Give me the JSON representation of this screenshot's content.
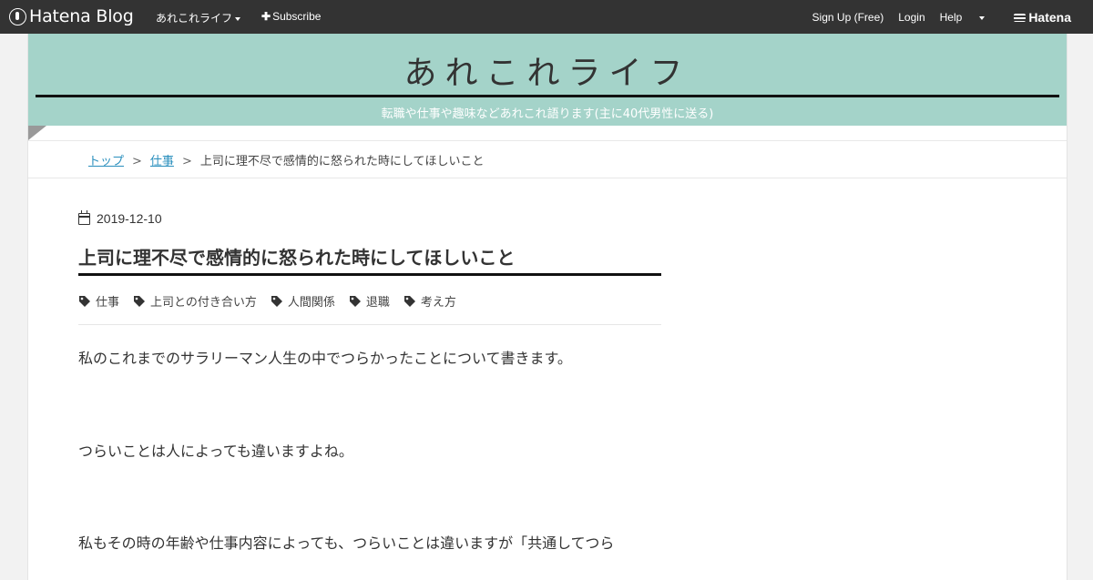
{
  "topbar": {
    "logo_text": "Hatena Blog",
    "blog_menu": "あれこれライフ",
    "subscribe": "Subscribe",
    "signup": "Sign Up (Free)",
    "login": "Login",
    "help": "Help",
    "brand": "Hatena"
  },
  "header": {
    "title": "あれこれライフ",
    "description": "転職や仕事や趣味などあれこれ語ります(主に40代男性に送る)",
    "bg_color": "#a4d3c9"
  },
  "breadcrumb": {
    "items": [
      "トップ",
      "仕事"
    ],
    "current": "上司に理不尽で感情的に怒られた時にしてほしいこと",
    "separator": ">"
  },
  "entry": {
    "date": "2019-12-10",
    "title": "上司に理不尽で感情的に怒られた時にしてほしいこと",
    "tags": [
      "仕事",
      "上司との付き合い方",
      "人間関係",
      "退職",
      "考え方"
    ],
    "paragraphs": [
      "私のこれまでのサラリーマン人生の中でつらかったことについて書きます。",
      "つらいことは人によっても違いますよね。",
      "私もその時の年齢や仕事内容によっても、つらいことは違いますが「共通してつら"
    ]
  }
}
